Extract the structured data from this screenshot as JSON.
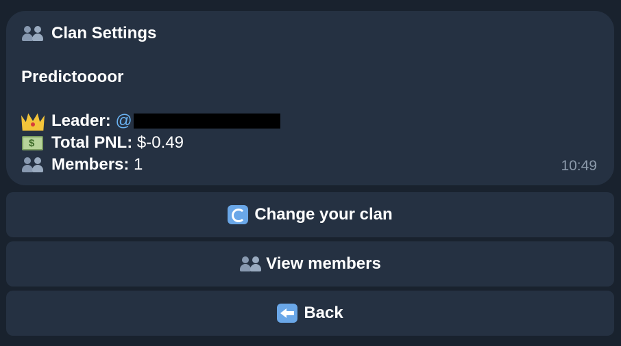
{
  "message": {
    "title": "Clan Settings",
    "clan_name": "Predictoooor",
    "leader_label": "Leader:",
    "leader_mention_prefix": "@",
    "pnl_label": "Total PNL:",
    "pnl_value": "$-0.49",
    "members_label": "Members:",
    "members_value": "1",
    "time": "10:49",
    "icons": {
      "title": "members-icon",
      "leader": "crown-icon",
      "pnl": "money-icon",
      "members": "members-icon"
    }
  },
  "keyboard": {
    "buttons": [
      {
        "label": "Change your clan",
        "icon": "refresh-icon"
      },
      {
        "label": "View members",
        "icon": "members-icon"
      },
      {
        "label": "Back",
        "icon": "back-arrow-icon"
      }
    ]
  },
  "colors": {
    "background": "#19222e",
    "bubble": "#253142",
    "mention": "#6ab3f3",
    "timestamp": "#8c9aab"
  }
}
